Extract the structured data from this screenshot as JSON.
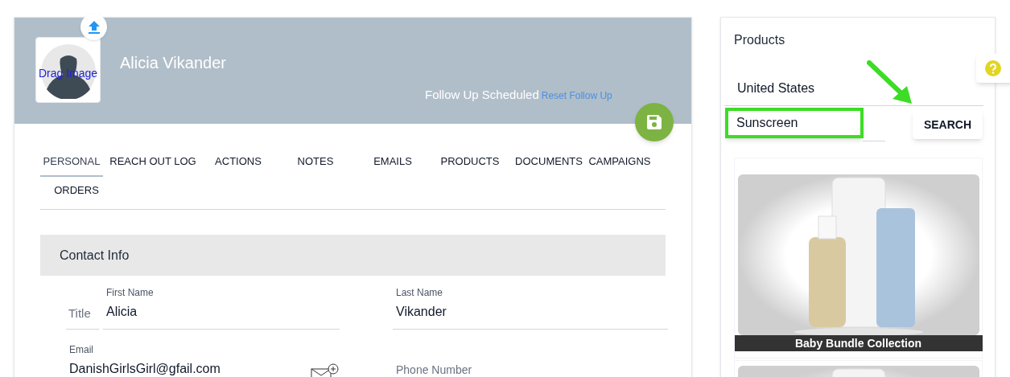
{
  "contact": {
    "name": "Alicia Vikander",
    "drag_image": "Drag Image",
    "follow_up": "Follow Up Scheduled",
    "reset_follow_up": "Reset Follow Up"
  },
  "tabs": [
    {
      "label": "PERSONAL",
      "selected": true
    },
    {
      "label": "REACH OUT LOG",
      "selected": false
    },
    {
      "label": "ACTIONS",
      "selected": false
    },
    {
      "label": "NOTES",
      "selected": false
    },
    {
      "label": "EMAILS",
      "selected": false
    },
    {
      "label": "PRODUCTS",
      "selected": false
    },
    {
      "label": "DOCUMENTS",
      "selected": false
    },
    {
      "label": "CAMPAIGNS",
      "selected": false
    },
    {
      "label": "ORDERS",
      "selected": false
    }
  ],
  "section": {
    "title": "Contact Info"
  },
  "fields": {
    "title": {
      "placeholder": "Title"
    },
    "first_name": {
      "label": "First Name",
      "value": "Alicia"
    },
    "last_name": {
      "label": "Last Name",
      "value": "Vikander"
    },
    "email": {
      "label": "Email",
      "value": "DanishGirlsGirl@gfail.com"
    },
    "phone": {
      "placeholder": "Phone Number"
    }
  },
  "products": {
    "title": "Products",
    "country": "United States",
    "search": {
      "value": "Sunscreen"
    },
    "search_button": "SEARCH",
    "items": [
      {
        "name": "Baby Bundle Collection",
        "kind": "picture"
      },
      {
        "kind": "picture"
      }
    ]
  }
}
